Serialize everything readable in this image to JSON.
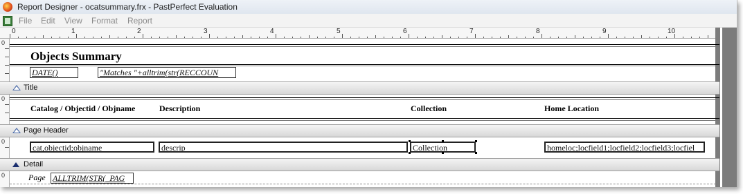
{
  "window": {
    "title": "Report Designer - ocatsummary.frx - PastPerfect Evaluation"
  },
  "menu": [
    "File",
    "Edit",
    "View",
    "Format",
    "Report"
  ],
  "ruler": {
    "numbers": [
      "0",
      "1",
      "2",
      "3",
      "4",
      "5",
      "6",
      "7",
      "8",
      "9",
      "10"
    ]
  },
  "gutter": {
    "zero": "0"
  },
  "title_band": {
    "label": "Title",
    "report_title": "Objects Summary",
    "date_field": "DATE()",
    "count_field": "\"Matches \"+alltrim(str(RECCOUN"
  },
  "page_header_band": {
    "label": "Page Header",
    "columns": [
      "Catalog / Objectid / Objname",
      "Description",
      "Collection",
      "Home Location"
    ]
  },
  "detail_band": {
    "label": "Detail",
    "fields": [
      "cat,objectid;objname",
      "descrip",
      "Collection",
      "homeloc;locfield1;locfield2;locfield3;locfiel"
    ]
  },
  "footer": {
    "page_label": "Page",
    "page_field": "ALLTRIM(STR(_PAG"
  }
}
